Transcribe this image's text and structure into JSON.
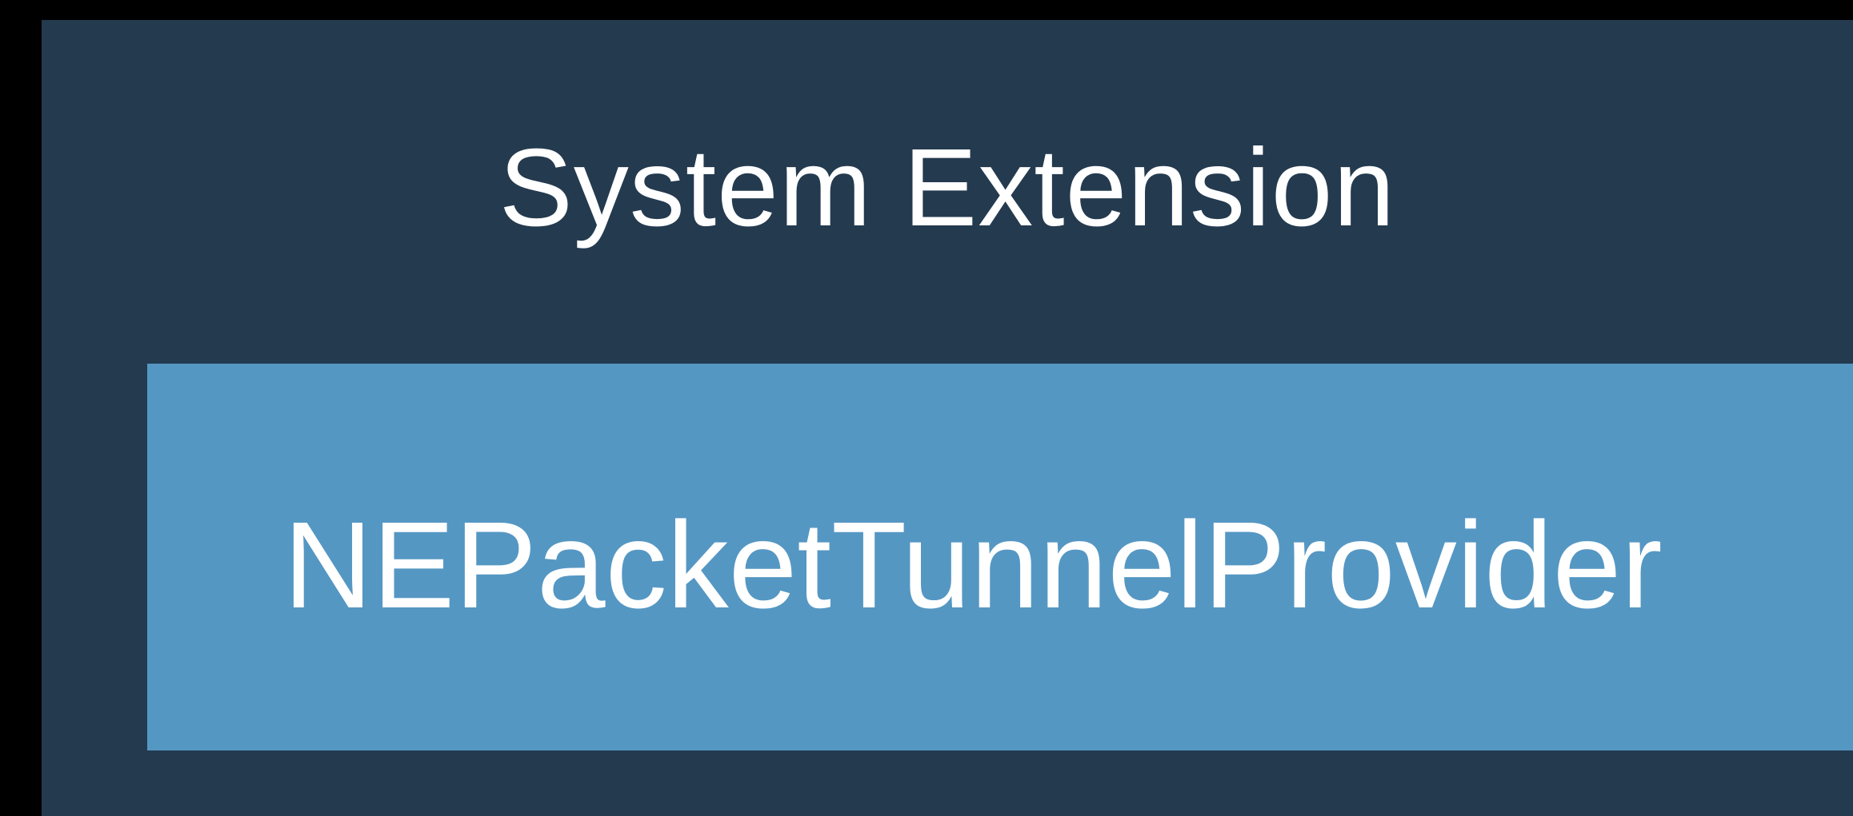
{
  "diagram": {
    "outer": {
      "label": "System Extension",
      "fill_color": "#243a4f"
    },
    "inner": {
      "label": "NEPacketTunnelProvider",
      "fill_color": "#5597c3"
    },
    "background_color": "#000000",
    "text_color": "#ffffff"
  }
}
